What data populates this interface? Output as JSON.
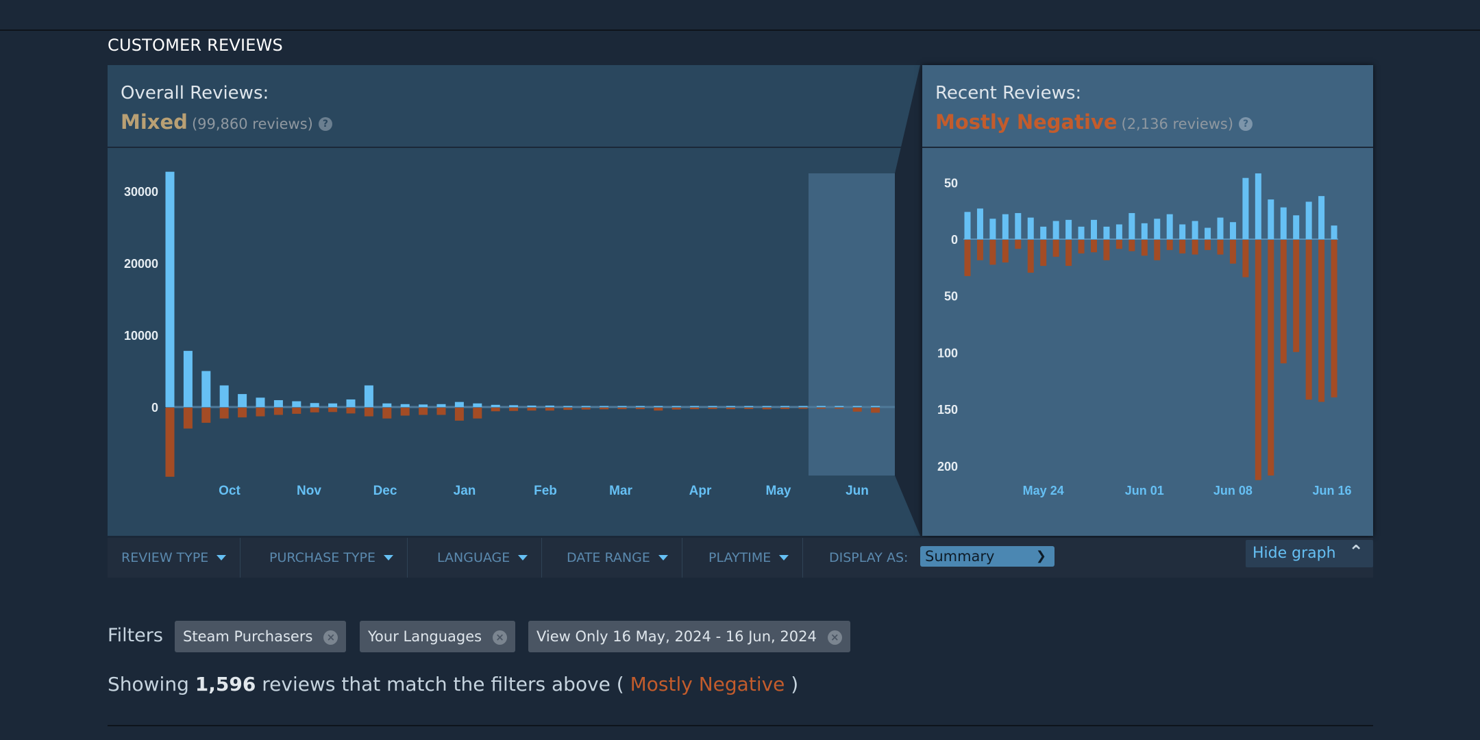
{
  "section_title": "CUSTOMER REVIEWS",
  "overall": {
    "label": "Overall Reviews:",
    "summary": "Mixed",
    "count": "(99,860 reviews)",
    "help": "?"
  },
  "recent": {
    "label": "Recent Reviews:",
    "summary": "Mostly Negative",
    "count": "(2,136 reviews)",
    "help": "?"
  },
  "colors": {
    "positive": "#66c0f4",
    "negative": "#a34c25",
    "mixed": "#b9a074",
    "mostly_negative": "#c35c2c",
    "background": "#1b2838"
  },
  "toolbar": {
    "filters": [
      "REVIEW TYPE",
      "PURCHASE TYPE",
      "LANGUAGE",
      "DATE RANGE",
      "PLAYTIME"
    ],
    "display_as_label": "DISPLAY AS:",
    "display_as_value": "Summary",
    "hide_graph": "Hide graph"
  },
  "filters": {
    "label": "Filters",
    "chips": [
      "Steam Purchasers",
      "Your Languages",
      "View Only 16 May, 2024 - 16 Jun, 2024"
    ]
  },
  "showing": {
    "prefix": "Showing",
    "count": "1,596",
    "middle": "reviews that match the filters above (",
    "summary": "Mostly Negative",
    "suffix": ")"
  },
  "chart_data": [
    {
      "type": "bar",
      "title": "",
      "y_tick_labels": [
        "30000",
        "20000",
        "10000",
        "0"
      ],
      "x_tick_labels": [
        "Oct",
        "Nov",
        "Dec",
        "Jan",
        "Feb",
        "Mar",
        "Apr",
        "May",
        "Jun"
      ],
      "ylim": [
        -10000,
        33000
      ],
      "highlighted_range": "16 May - 16 Jun",
      "series": [
        {
          "values": [
            32700,
            7800,
            5000,
            3000,
            1800,
            1300,
            950,
            800,
            550,
            500,
            1050,
            3000,
            500,
            400,
            350,
            400,
            700,
            500,
            300,
            250,
            200,
            200,
            150,
            150,
            130,
            120,
            110,
            100,
            120,
            100,
            90,
            90,
            80,
            100,
            80,
            80,
            100,
            80,
            120,
            100
          ]
        },
        {
          "values": [
            -9600,
            -2900,
            -2100,
            -1500,
            -1350,
            -1200,
            -1000,
            -850,
            -650,
            -600,
            -800,
            -1200,
            -1500,
            -1100,
            -1000,
            -1000,
            -1800,
            -1500,
            -500,
            -450,
            -400,
            -400,
            -300,
            -250,
            -220,
            -200,
            -200,
            -400,
            -250,
            -200,
            -180,
            -200,
            -180,
            -220,
            -180,
            -150,
            -150,
            -150,
            -550,
            -700
          ]
        }
      ]
    },
    {
      "type": "bar",
      "title": "",
      "y_tick_labels": [
        "50",
        "0",
        "50",
        "100",
        "150",
        "200"
      ],
      "x_tick_labels": [
        "May 24",
        "Jun 01",
        "Jun 08",
        "Jun 16"
      ],
      "ylim": [
        -220,
        60
      ],
      "series": [
        {
          "values": [
            24,
            27,
            18,
            22,
            23,
            19,
            11,
            16,
            17,
            11,
            17,
            11,
            13,
            23,
            14,
            18,
            22,
            13,
            16,
            10,
            19,
            15,
            54,
            58,
            35,
            28,
            21,
            33,
            38,
            12
          ]
        },
        {
          "values": [
            -32,
            -18,
            -22,
            -20,
            -8,
            -29,
            -23,
            -15,
            -23,
            -12,
            -11,
            -18,
            -8,
            -10,
            -14,
            -18,
            -9,
            -12,
            -13,
            -9,
            -13,
            -21,
            -33,
            -212,
            -208,
            -109,
            -99,
            -141,
            -143,
            -139
          ]
        }
      ]
    }
  ]
}
